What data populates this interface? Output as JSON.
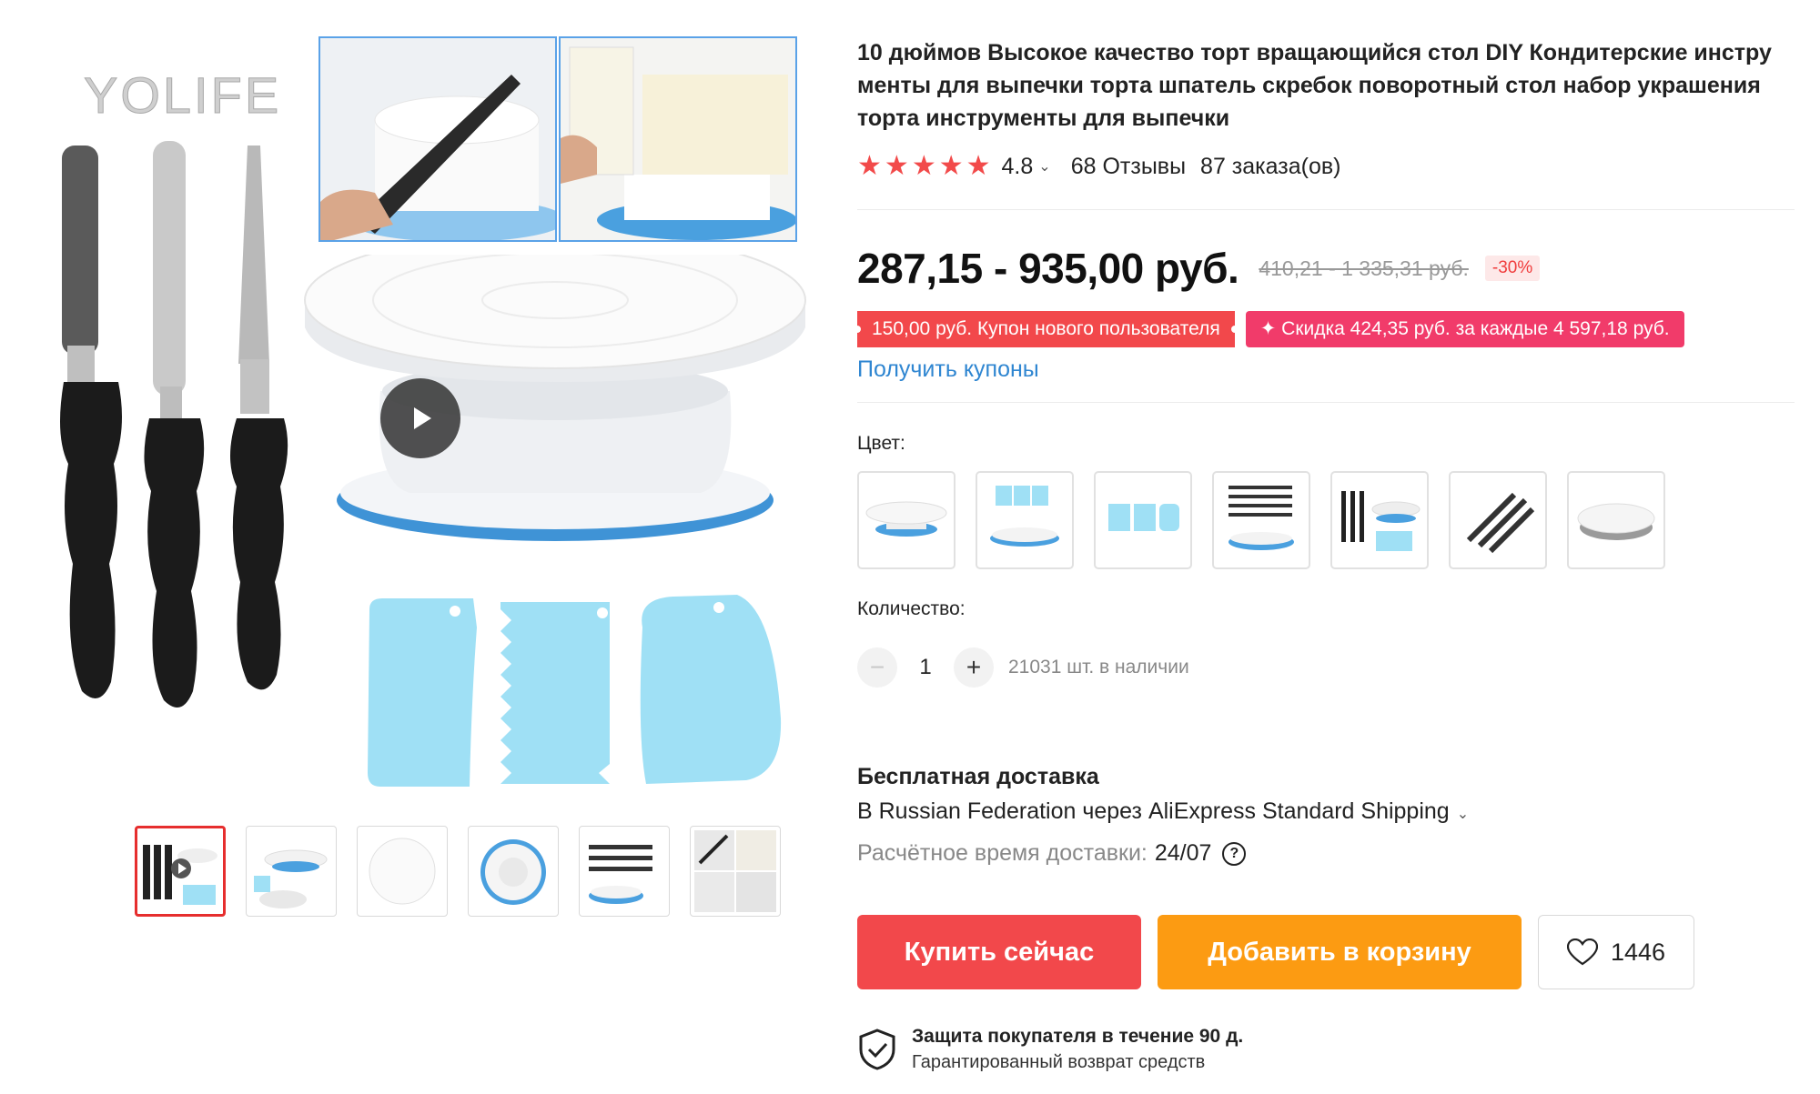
{
  "gallery": {
    "brand_watermark": "YOLIFE",
    "thumbnails": [
      "thumb-1",
      "thumb-2",
      "thumb-3",
      "thumb-4",
      "thumb-5",
      "thumb-6"
    ],
    "active_thumbnail": 1
  },
  "product": {
    "title": "10 дюймов Высокое качество торт вращающийся стол DIY Кондитерские инстру менты для выпечки торта шпатель скребок поворотный стол набор украшения торта инструменты для выпечки",
    "rating": {
      "stars": 5,
      "value": "4.8",
      "reviews": "68 Отзывы",
      "orders": "87 заказа(ов)"
    },
    "price": {
      "current": "287,15 - 935,00 руб.",
      "old": "410,21 - 1 335,31 руб.",
      "discount": "-30%"
    },
    "coupons": {
      "new_user": "150,00 руб. Купон нового пользователя",
      "store": "✦ Скидка 424,35 руб. за каждые 4 597,18 руб.",
      "get_link": "Получить купоны"
    },
    "color_label": "Цвет:",
    "color_options": [
      "turntable",
      "scrapers-turntable",
      "scrapers",
      "spatulas-turntable",
      "full-set",
      "spatulas",
      "turntable-grey"
    ],
    "quantity": {
      "label": "Количество:",
      "value": "1",
      "stock": "21031 шт. в наличии"
    },
    "shipping": {
      "title": "Бесплатная доставка",
      "method": "В Russian Federation через AliExpress Standard Shipping",
      "estimate_label": "Расчётное время доставки:",
      "estimate_date": "24/07"
    },
    "actions": {
      "buy": "Купить сейчас",
      "cart": "Добавить в корзину",
      "wishlist_count": "1446"
    },
    "protection": {
      "title": "Защита покупателя в течение 90 д.",
      "subtitle": "Гарантированный возврат средств"
    }
  },
  "colors": {
    "accent_red": "#f2484b",
    "cart_orange": "#fc9b12",
    "link_blue": "#2f86d1",
    "star_red": "#f24a4a",
    "coupon_pink": "#f13b6a",
    "scraper_blue": "#9fe0f5",
    "turntable_blue": "#3f93d6"
  }
}
